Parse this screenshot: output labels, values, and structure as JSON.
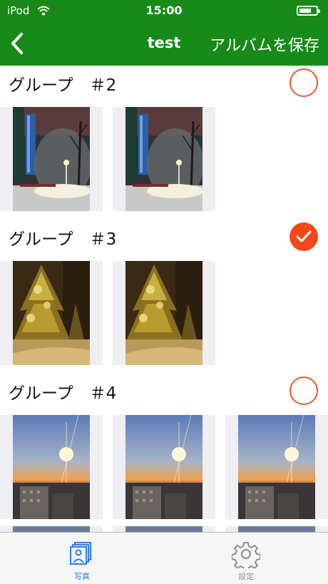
{
  "status_bar": {
    "carrier": "iPod",
    "time": "15:00"
  },
  "nav": {
    "title": "test",
    "save_label": "アルバムを保存"
  },
  "groups": [
    {
      "label": "グループ　＃2",
      "selected": false
    },
    {
      "label": "グループ　＃3",
      "selected": true
    },
    {
      "label": "グループ　＃4",
      "selected": false
    }
  ],
  "tabs": [
    {
      "label": "写真",
      "icon": "photos-icon",
      "active": true
    },
    {
      "label": "設定",
      "icon": "gear-icon",
      "active": false
    }
  ],
  "colors": {
    "accent_green": "#178a17",
    "select_orange": "#f0481c",
    "tab_active": "#2b7de9",
    "tab_inactive": "#8e8e8e"
  }
}
